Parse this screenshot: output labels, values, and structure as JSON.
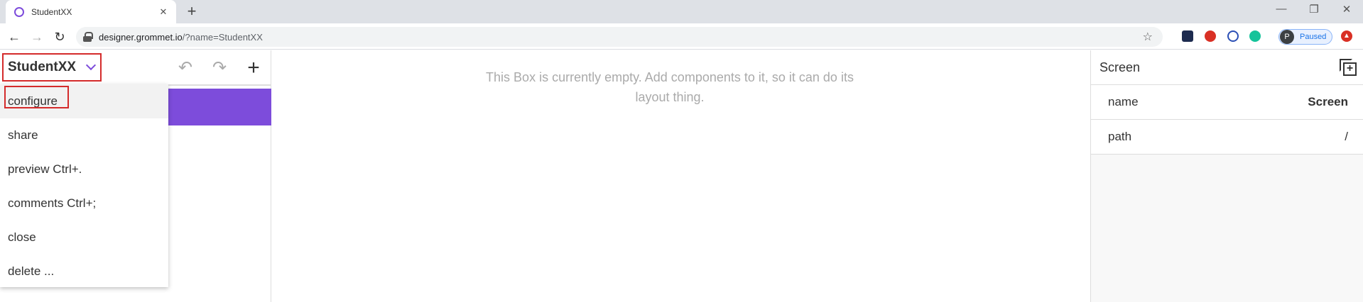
{
  "browser": {
    "tab_title": "StudentXX",
    "tab_close": "✕",
    "new_tab": "+",
    "window_controls": [
      "—",
      "❐",
      "✕"
    ],
    "url_host": "designer.grommet.io",
    "url_path": "/?name=StudentXX",
    "profile_initial": "P",
    "profile_status": "Paused",
    "accent": "#7d4cdb"
  },
  "app": {
    "name": "StudentXX",
    "menu": [
      {
        "label": "configure"
      },
      {
        "label": "share"
      },
      {
        "label": "preview Ctrl+."
      },
      {
        "label": "comments Ctrl+;"
      },
      {
        "label": "close"
      },
      {
        "label": "delete ..."
      }
    ],
    "canvas_empty_message": "This Box is currently empty. Add components to it, so it can do its layout thing.",
    "properties": {
      "title": "Screen",
      "rows": [
        {
          "name": "name",
          "value": "Screen"
        },
        {
          "name": "path",
          "value": "/"
        }
      ]
    }
  }
}
